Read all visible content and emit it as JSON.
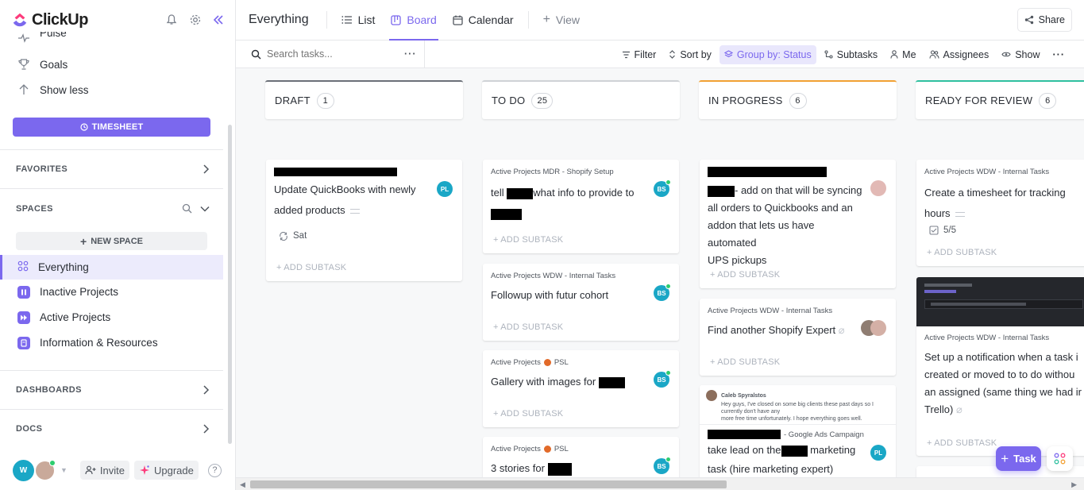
{
  "app": {
    "name": "ClickUp"
  },
  "sidebar": {
    "partial_item": "Pulse",
    "goals_label": "Goals",
    "show_less_label": "Show less",
    "timesheet_label": "TIMESHEET",
    "favorites_label": "FAVORITES",
    "spaces_label": "SPACES",
    "new_space_label": "NEW SPACE",
    "spaces": [
      {
        "label": "Everything",
        "active": true,
        "color": "#7b68ee"
      },
      {
        "label": "Inactive Projects",
        "color": "#7b68ee"
      },
      {
        "label": "Active Projects",
        "color": "#7b68ee"
      },
      {
        "label": "Information & Resources",
        "color": "#7b68ee"
      }
    ],
    "dashboards_label": "DASHBOARDS",
    "docs_label": "DOCS",
    "footer": {
      "avatar_initial": "W",
      "invite_label": "Invite",
      "upgrade_label": "Upgrade",
      "help_label": "?"
    }
  },
  "topbar": {
    "title": "Everything",
    "tabs": [
      {
        "label": "List",
        "icon": "list-icon"
      },
      {
        "label": "Board",
        "icon": "board-icon",
        "active": true
      },
      {
        "label": "Calendar",
        "icon": "calendar-icon"
      }
    ],
    "add_view_label": "View",
    "share_label": "Share"
  },
  "filterbar": {
    "search_placeholder": "Search tasks...",
    "more_label": "···",
    "filter_label": "Filter",
    "sort_label": "Sort by",
    "group_label": "Group by: Status",
    "subtasks_label": "Subtasks",
    "me_label": "Me",
    "assignees_label": "Assignees",
    "show_label": "Show"
  },
  "columns": [
    {
      "name": "DRAFT",
      "count": "1",
      "color": "#6b7078"
    },
    {
      "name": "TO DO",
      "count": "25",
      "color": "#cfd2d6"
    },
    {
      "name": "IN PROGRESS",
      "count": "6",
      "color": "#f2a134"
    },
    {
      "name": "READY FOR REVIEW",
      "count": "6",
      "color": "#2fc0a0"
    }
  ],
  "add_subtask_label": "+ ADD SUBTASK",
  "cards": {
    "draft_1": {
      "title_a": "Update QuickBooks with newly",
      "title_b": "added products",
      "due": "Sat",
      "assignee": "PL"
    },
    "todo_1": {
      "crumb": "Active Projects MDR - Shopify Setup",
      "title_a": "tell",
      "title_b": "what info to provide to",
      "assignee": "BS"
    },
    "todo_2": {
      "crumb": "Active Projects WDW - Internal Tasks",
      "title": "Followup with futur cohort",
      "assignee": "BS"
    },
    "todo_3": {
      "crumb": "Active Projects",
      "crumb_b": "PSL",
      "title": "Gallery with images for",
      "assignee": "BS"
    },
    "todo_4": {
      "crumb": "Active Projects",
      "crumb_b": "PSL",
      "title": "3 stories for",
      "assignee": "BS"
    },
    "prog_1": {
      "title_a": "- add on that will be syncing",
      "title_b": "all orders to Quickbooks and an",
      "title_c": "addon that lets us have automated",
      "title_d": "UPS pickups"
    },
    "prog_2": {
      "crumb": "Active Projects WDW - Internal Tasks",
      "title": "Find another Shopify Expert"
    },
    "prog_3": {
      "comment_author": "Caleb Spyralstos",
      "comment_text_a": "Hey guys, I've closed on some big clients these past days so I currently don't have any",
      "comment_text_b": "more free time unfortunately. I hope everything goes well.",
      "crumb_b": "- Google Ads Campaign",
      "title_a": "take lead on the",
      "title_b": "marketing",
      "title_c": "task (hire marketing expert)",
      "assignee": "PL"
    },
    "review_1": {
      "crumb": "Active Projects WDW - Internal Tasks",
      "title_a": "Create a timesheet for tracking",
      "title_b": "hours",
      "checklist": "5/5"
    },
    "review_2": {
      "crumb": "Active Projects WDW - Internal Tasks",
      "title_a": "Set up a notification when a task i",
      "title_b": "created or moved to to do withou",
      "title_c": "an assigned (same thing we had ir",
      "title_d": "Trello)"
    }
  },
  "fab": {
    "task_label": "Task"
  }
}
